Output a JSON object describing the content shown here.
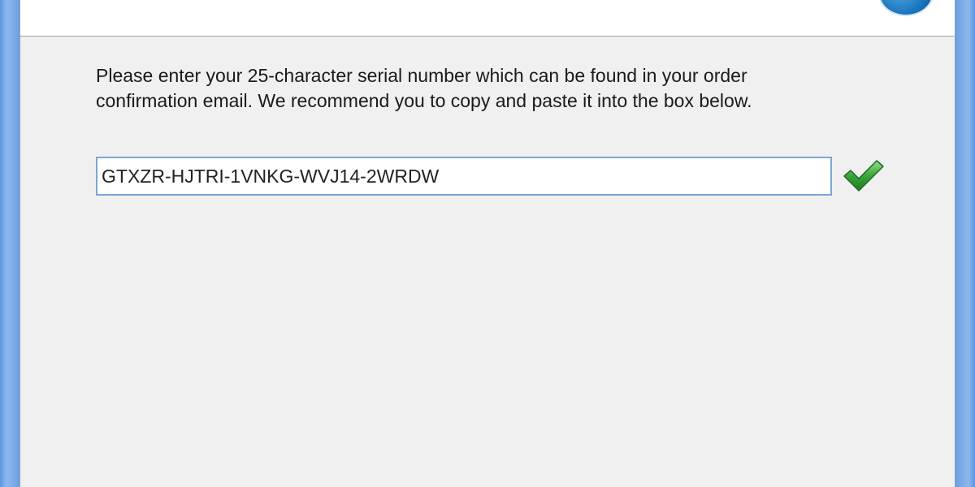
{
  "header": {
    "title": ""
  },
  "instructions": {
    "text": "Please enter your 25-character serial number which can be found in your order confirmation email. We recommend you to copy and paste it into the box below."
  },
  "serial": {
    "value": "GTXZR-HJTRI-1VNKG-WVJ14-2WRDW",
    "status_icon": "checkmark-icon",
    "status_color": "#3aa53a"
  },
  "colors": {
    "window_frame": "#6c9fe2",
    "dialog_bg": "#f0f0f0",
    "input_border": "#7aa7d9"
  }
}
